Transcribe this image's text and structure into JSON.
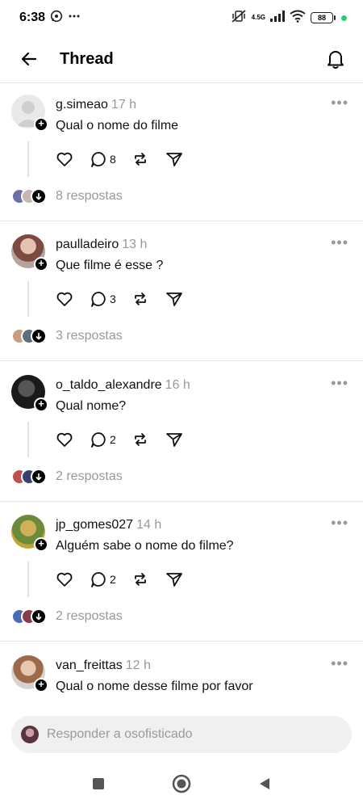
{
  "status_bar": {
    "time": "6:38",
    "network_label": "4.5G",
    "battery": "88"
  },
  "header": {
    "title": "Thread"
  },
  "posts": [
    {
      "username": "g.simeao",
      "time": "17 h",
      "text": "Qual o nome do filme",
      "comment_count": "8",
      "replies_text": "8 respostas"
    },
    {
      "username": "paulladeiro",
      "time": "13 h",
      "text": "Que filme é esse ?",
      "comment_count": "3",
      "replies_text": "3 respostas"
    },
    {
      "username": "o_taldo_alexandre",
      "time": "16 h",
      "text": "Qual nome?",
      "comment_count": "2",
      "replies_text": "2 respostas"
    },
    {
      "username": "jp_gomes027",
      "time": "14 h",
      "text": "Alguém sabe o nome do filme?",
      "comment_count": "2",
      "replies_text": "2 respostas"
    },
    {
      "username": "van_freittas",
      "time": "12 h",
      "text": "Qual o nome desse filme por favor"
    }
  ],
  "reply_bar": {
    "placeholder": "Responder a osofisticado"
  },
  "colors": {
    "secondary_text": "#999999",
    "divider": "#e6e6e6",
    "status_dot": "#2ecc71"
  }
}
